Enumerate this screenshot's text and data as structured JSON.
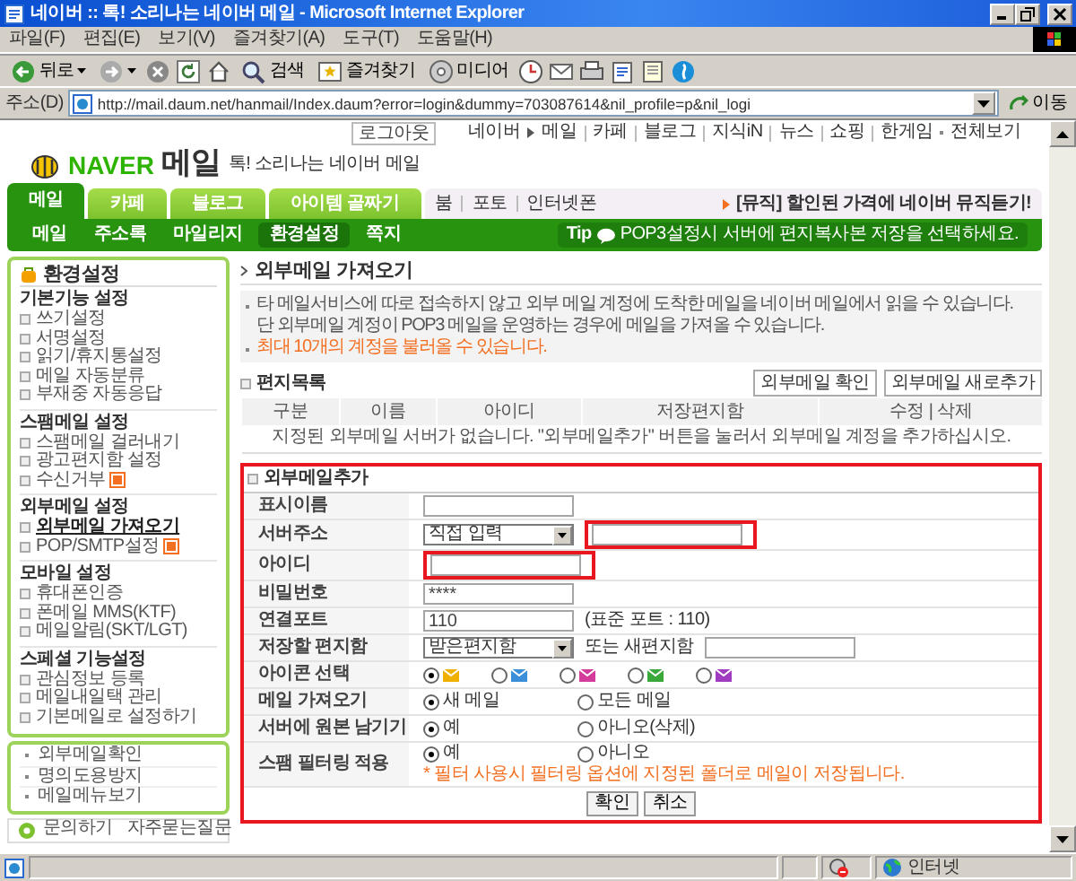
{
  "window": {
    "title": "네이버 :: 톡! 소리나는 네이버 메일 - Microsoft Internet Explorer"
  },
  "menu_bar": [
    "파일(F)",
    "편집(E)",
    "보기(V)",
    "즐겨찾기(A)",
    "도구(T)",
    "도움말(H)"
  ],
  "toolbar": [
    {
      "kind": "back",
      "label": "뒤로"
    },
    {
      "kind": "forward"
    },
    {
      "kind": "stop"
    },
    {
      "kind": "refresh"
    },
    {
      "kind": "home"
    },
    {
      "kind": "search",
      "label": "검색"
    },
    {
      "kind": "favorites",
      "label": "즐겨찾기"
    },
    {
      "kind": "media",
      "label": "미디어"
    },
    {
      "kind": "history"
    },
    {
      "kind": "mail"
    },
    {
      "kind": "print"
    },
    {
      "kind": "edit"
    },
    {
      "kind": "discuss"
    },
    {
      "kind": "messenger"
    }
  ],
  "address_bar": {
    "label": "주소(D)",
    "url": "http://mail.daum.net/hanmail/Index.daum?error=login&dummy=703087614&nil_profile=p&nil_logi",
    "go": "이동"
  },
  "site_header": {
    "logout": "로그아웃",
    "links": [
      "네이버",
      "메일",
      "카페",
      "블로그",
      "지식iN",
      "뉴스",
      "쇼핑",
      "한게임",
      "전체보기"
    ],
    "logo": "NAVER",
    "service_name": "메일",
    "slogan": "톡! 소리나는 네이버 메일"
  },
  "tabs": [
    {
      "label": "메일",
      "selected": true
    },
    {
      "label": "카페",
      "selected": false
    },
    {
      "label": "블로그",
      "selected": false
    },
    {
      "label": "아이템 골짜기",
      "selected": false
    }
  ],
  "tab_links": [
    "붐",
    "포토",
    "인터넷폰"
  ],
  "promo": "[뮤직] 할인된 가격에 네이버 뮤직듣기!",
  "subnav": [
    {
      "label": "메일",
      "selected": false
    },
    {
      "label": "주소록",
      "selected": false
    },
    {
      "label": "마일리지",
      "selected": false
    },
    {
      "label": "환경설정",
      "selected": true
    },
    {
      "label": "쪽지",
      "selected": false
    }
  ],
  "tip": {
    "label": "Tip",
    "text": "POP3설정시 서버에 편지복사본 저장을 선택하세요."
  },
  "sidebar": {
    "title": "환경설정",
    "groups": [
      {
        "title": "기본기능 설정",
        "items": [
          {
            "label": "쓰기설정",
            "selected": false,
            "new": false
          },
          {
            "label": "서명설정",
            "selected": false,
            "new": false
          },
          {
            "label": "읽기/휴지통설정",
            "selected": false,
            "new": false
          },
          {
            "label": "메일 자동분류",
            "selected": false,
            "new": false
          },
          {
            "label": "부재중 자동응답",
            "selected": false,
            "new": false
          }
        ]
      },
      {
        "title": "스팸메일 설정",
        "items": [
          {
            "label": "스팸메일 걸러내기",
            "selected": false,
            "new": false
          },
          {
            "label": "광고편지함 설정",
            "selected": false,
            "new": false
          },
          {
            "label": "수신거부",
            "selected": false,
            "new": true
          }
        ]
      },
      {
        "title": "외부메일 설정",
        "items": [
          {
            "label": "외부메일 가져오기",
            "selected": true,
            "new": false
          },
          {
            "label": "POP/SMTP설정",
            "selected": false,
            "new": true
          }
        ]
      },
      {
        "title": "모바일 설정",
        "items": [
          {
            "label": "휴대폰인증",
            "selected": false,
            "new": false
          },
          {
            "label": "폰메일 MMS(KTF)",
            "selected": false,
            "new": false
          },
          {
            "label": "메일알림(SKT/LGT)",
            "selected": false,
            "new": false
          }
        ]
      },
      {
        "title": "스페셜 기능설정",
        "items": [
          {
            "label": "관심정보 등록",
            "selected": false,
            "new": false
          },
          {
            "label": "메일내일택 관리",
            "selected": false,
            "new": false
          },
          {
            "label": "기본메일로 설정하기",
            "selected": false,
            "new": false
          }
        ]
      }
    ],
    "links": [
      "외부메일확인",
      "명의도용방지",
      "메일메뉴보기"
    ],
    "footer": [
      "문의하기",
      "자주묻는질문"
    ]
  },
  "page_title": "외부메일 가져오기",
  "notices": [
    {
      "kind": "info",
      "lines": [
        "타 메일서비스에 따로 접속하지 않고 외부 메일 계정에 도착한 메일을 네이버 메일에서 읽을 수 있습니다.",
        "단 외부메일 계정이 POP3 메일을 운영하는 경우에 메일을 가져올 수 있습니다."
      ]
    },
    {
      "kind": "warning",
      "lines": [
        "최대 10개의 계정을 불러올 수 있습니다."
      ]
    }
  ],
  "mail_list": {
    "title": "편지목록",
    "buttons": [
      "외부메일 확인",
      "외부메일 새로추가"
    ],
    "columns": [
      "구분",
      "이름",
      "아이디",
      "저장편지함",
      "수정 | 삭제"
    ],
    "empty_message": "지정된 외부메일 서버가 없습니다. \"외부메일추가\" 버튼을 눌러서 외부메일 계정을 추가하십시오."
  },
  "add_form": {
    "title": "외부메일추가",
    "highlighted": true,
    "rows": [
      {
        "label": "표시이름",
        "kind": "text"
      },
      {
        "label": "서버주소",
        "kind": "select_text",
        "select": "직접 입력",
        "highlighted": true
      },
      {
        "label": "아이디",
        "kind": "text",
        "highlighted": true
      },
      {
        "label": "비밀번호",
        "kind": "text",
        "value": "****"
      },
      {
        "label": "연결포트",
        "kind": "text",
        "value": "110",
        "note": "(표준 포트 : 110)"
      },
      {
        "label": "저장할 편지함",
        "kind": "select_text",
        "select": "받은편지함",
        "middle_label": "또는 새편지함"
      },
      {
        "label": "아이콘 선택",
        "kind": "icons",
        "options": [
          {
            "color": "#f0b000",
            "selected": true
          },
          {
            "color": "#3a8fd8",
            "selected": false
          },
          {
            "color": "#d43c9c",
            "selected": false
          },
          {
            "color": "#3aa83a",
            "selected": false
          },
          {
            "color": "#a03cc0",
            "selected": false
          }
        ]
      },
      {
        "label": "메일 가져오기",
        "kind": "radio",
        "options": [
          {
            "label": "새 메일",
            "selected": true
          },
          {
            "label": "모든 메일",
            "selected": false
          }
        ]
      },
      {
        "label": "서버에 원본 남기기",
        "kind": "radio",
        "options": [
          {
            "label": "예",
            "selected": true
          },
          {
            "label": "아니오(삭제)",
            "selected": false
          }
        ]
      },
      {
        "label": "스팸 필터링 적용",
        "kind": "radio",
        "options": [
          {
            "label": "예",
            "selected": true
          },
          {
            "label": "아니오",
            "selected": false
          }
        ],
        "note": "* 필터 사용시 필터링 옵션에 지정된 폴더로 메일이 저장됩니다."
      }
    ],
    "buttons": [
      "확인",
      "취소"
    ]
  },
  "status_bar": {
    "zone": "인터넷"
  }
}
